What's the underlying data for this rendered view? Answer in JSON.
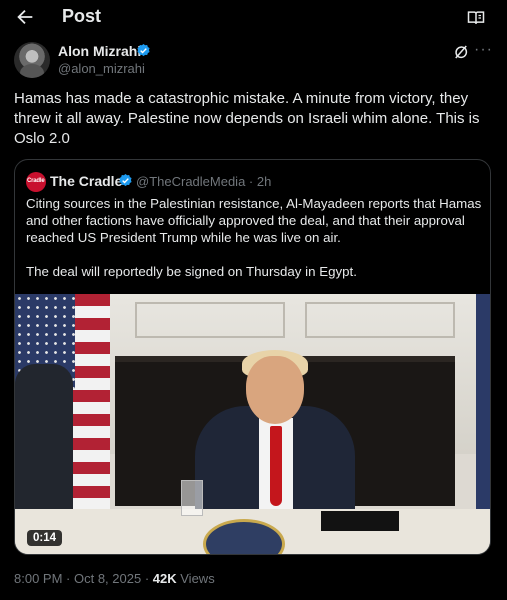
{
  "header": {
    "title": "Post",
    "back_icon": "arrow-left-icon",
    "reader_icon": "book-open-icon"
  },
  "post": {
    "author_name": "Alon Mizrahi",
    "author_handle": "@alon_mizrahi",
    "verified_color": "#1d9bf0",
    "text": "Hamas has made a catastrophic mistake. A minute from victory, they threw it all away. Palestine now depends on Israeli whim alone. This is Oslo 2.0",
    "time": "8:00 PM",
    "date": "Oct 8, 2025",
    "views_count": "42K",
    "views_label": "Views"
  },
  "quote": {
    "author_name": "The Cradle",
    "avatar_text": "Cradle",
    "author_handle": "@TheCradleMedia",
    "age": "2h",
    "paragraph1": "Citing sources in the Palestinian resistance, Al-Mayadeen reports that Hamas and other factions have officially approved the deal, and that their approval reached US President Trump while he was live on air.",
    "paragraph2": "The deal will reportedly be signed on Thursday in Egypt.",
    "video_duration": "0:14"
  }
}
